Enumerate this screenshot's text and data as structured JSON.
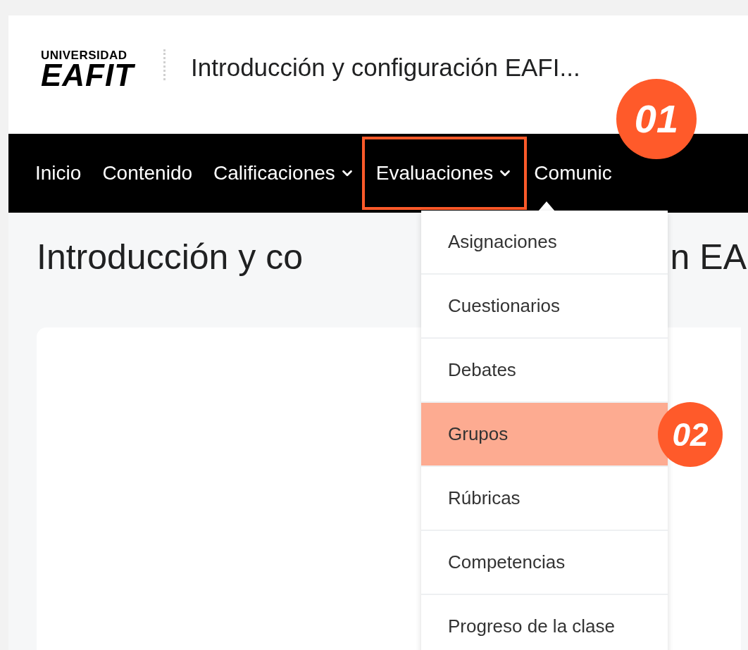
{
  "header": {
    "logo": {
      "line_1": "UNIVERSIDAD",
      "line_2": "EAFIT"
    },
    "course_title": "Introducción y configuración EAFI..."
  },
  "nav": {
    "items": [
      {
        "label": "Inicio",
        "has_menu": false,
        "selected": false
      },
      {
        "label": "Contenido",
        "has_menu": false,
        "selected": false
      },
      {
        "label": "Calificaciones",
        "has_menu": true,
        "selected": false
      },
      {
        "label": "Evaluaciones",
        "has_menu": true,
        "selected": true
      },
      {
        "label": "Comunic",
        "has_menu": false,
        "selected": false
      }
    ]
  },
  "page_heading_parts": [
    "Introducción y co",
    "n EA"
  ],
  "dropdown": {
    "items": [
      {
        "label": "Asignaciones",
        "selected": false
      },
      {
        "label": "Cuestionarios",
        "selected": false
      },
      {
        "label": "Debates",
        "selected": false
      },
      {
        "label": "Grupos",
        "selected": true
      },
      {
        "label": "Rúbricas",
        "selected": false
      },
      {
        "label": "Competencias",
        "selected": false
      },
      {
        "label": "Progreso de la clase",
        "selected": false
      }
    ]
  },
  "callouts": [
    "01",
    "02"
  ]
}
